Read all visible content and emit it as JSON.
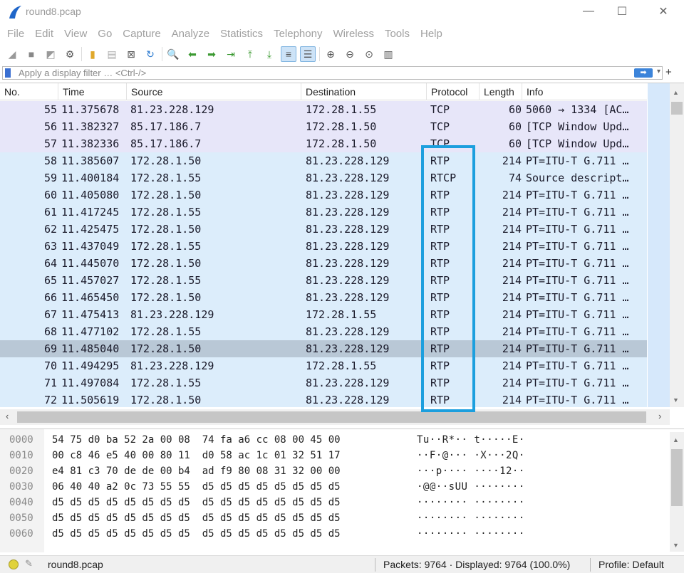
{
  "window": {
    "title": "round8.pcap",
    "minimize": "—",
    "maximize": "☐",
    "close": "✕"
  },
  "menu": [
    "File",
    "Edit",
    "View",
    "Go",
    "Capture",
    "Analyze",
    "Statistics",
    "Telephony",
    "Wireless",
    "Tools",
    "Help"
  ],
  "filter": {
    "placeholder": "Apply a display filter … <Ctrl-/>",
    "apply": "➡",
    "dropdown": "▾",
    "plus": "+"
  },
  "columns": {
    "no": "No.",
    "time": "Time",
    "source": "Source",
    "destination": "Destination",
    "protocol": "Protocol",
    "length": "Length",
    "info": "Info"
  },
  "packets": [
    {
      "no": "55",
      "time": "11.375678",
      "src": "81.23.228.129",
      "dst": "172.28.1.55",
      "proto": "TCP",
      "len": "60",
      "info": "5060 → 1334 [AC…"
    },
    {
      "no": "56",
      "time": "11.382327",
      "src": "85.17.186.7",
      "dst": "172.28.1.50",
      "proto": "TCP",
      "len": "60",
      "info": "[TCP Window Upd…"
    },
    {
      "no": "57",
      "time": "11.382336",
      "src": "85.17.186.7",
      "dst": "172.28.1.50",
      "proto": "TCP",
      "len": "60",
      "info": "[TCP Window Upd…"
    },
    {
      "no": "58",
      "time": "11.385607",
      "src": "172.28.1.50",
      "dst": "81.23.228.129",
      "proto": "RTP",
      "len": "214",
      "info": "PT=ITU-T G.711 …"
    },
    {
      "no": "59",
      "time": "11.400184",
      "src": "172.28.1.55",
      "dst": "81.23.228.129",
      "proto": "RTCP",
      "len": "74",
      "info": "Source descript…"
    },
    {
      "no": "60",
      "time": "11.405080",
      "src": "172.28.1.50",
      "dst": "81.23.228.129",
      "proto": "RTP",
      "len": "214",
      "info": "PT=ITU-T G.711 …"
    },
    {
      "no": "61",
      "time": "11.417245",
      "src": "172.28.1.55",
      "dst": "81.23.228.129",
      "proto": "RTP",
      "len": "214",
      "info": "PT=ITU-T G.711 …"
    },
    {
      "no": "62",
      "time": "11.425475",
      "src": "172.28.1.50",
      "dst": "81.23.228.129",
      "proto": "RTP",
      "len": "214",
      "info": "PT=ITU-T G.711 …"
    },
    {
      "no": "63",
      "time": "11.437049",
      "src": "172.28.1.55",
      "dst": "81.23.228.129",
      "proto": "RTP",
      "len": "214",
      "info": "PT=ITU-T G.711 …"
    },
    {
      "no": "64",
      "time": "11.445070",
      "src": "172.28.1.50",
      "dst": "81.23.228.129",
      "proto": "RTP",
      "len": "214",
      "info": "PT=ITU-T G.711 …"
    },
    {
      "no": "65",
      "time": "11.457027",
      "src": "172.28.1.55",
      "dst": "81.23.228.129",
      "proto": "RTP",
      "len": "214",
      "info": "PT=ITU-T G.711 …"
    },
    {
      "no": "66",
      "time": "11.465450",
      "src": "172.28.1.50",
      "dst": "81.23.228.129",
      "proto": "RTP",
      "len": "214",
      "info": "PT=ITU-T G.711 …"
    },
    {
      "no": "67",
      "time": "11.475413",
      "src": "81.23.228.129",
      "dst": "172.28.1.55",
      "proto": "RTP",
      "len": "214",
      "info": "PT=ITU-T G.711 …"
    },
    {
      "no": "68",
      "time": "11.477102",
      "src": "172.28.1.55",
      "dst": "81.23.228.129",
      "proto": "RTP",
      "len": "214",
      "info": "PT=ITU-T G.711 …"
    },
    {
      "no": "69",
      "time": "11.485040",
      "src": "172.28.1.50",
      "dst": "81.23.228.129",
      "proto": "RTP",
      "len": "214",
      "info": "PT=ITU-T G.711 …",
      "selected": true
    },
    {
      "no": "70",
      "time": "11.494295",
      "src": "81.23.228.129",
      "dst": "172.28.1.55",
      "proto": "RTP",
      "len": "214",
      "info": "PT=ITU-T G.711 …"
    },
    {
      "no": "71",
      "time": "11.497084",
      "src": "172.28.1.55",
      "dst": "81.23.228.129",
      "proto": "RTP",
      "len": "214",
      "info": "PT=ITU-T G.711 …"
    },
    {
      "no": "72",
      "time": "11.505619",
      "src": "172.28.1.50",
      "dst": "81.23.228.129",
      "proto": "RTP",
      "len": "214",
      "info": "PT=ITU-T G.711 …"
    }
  ],
  "hex": [
    {
      "off": "0000",
      "bytes": "54 75 d0 ba 52 2a 00 08  74 fa a6 cc 08 00 45 00",
      "ascii": "Tu··R*·· t·····E·"
    },
    {
      "off": "0010",
      "bytes": "00 c8 46 e5 40 00 80 11  d0 58 ac 1c 01 32 51 17",
      "ascii": "··F·@··· ·X···2Q·"
    },
    {
      "off": "0020",
      "bytes": "e4 81 c3 70 de de 00 b4  ad f9 80 08 31 32 00 00",
      "ascii": "···p···· ····12··"
    },
    {
      "off": "0030",
      "bytes": "06 40 40 a2 0c 73 55 55  d5 d5 d5 d5 d5 d5 d5 d5",
      "ascii": "·@@··sUU ········"
    },
    {
      "off": "0040",
      "bytes": "d5 d5 d5 d5 d5 d5 d5 d5  d5 d5 d5 d5 d5 d5 d5 d5",
      "ascii": "········ ········"
    },
    {
      "off": "0050",
      "bytes": "d5 d5 d5 d5 d5 d5 d5 d5  d5 d5 d5 d5 d5 d5 d5 d5",
      "ascii": "········ ········"
    },
    {
      "off": "0060",
      "bytes": "d5 d5 d5 d5 d5 d5 d5 d5  d5 d5 d5 d5 d5 d5 d5 d5",
      "ascii": "········ ········"
    }
  ],
  "status": {
    "file": "round8.pcap",
    "packets": "Packets: 9764 · Displayed: 9764 (100.0%)",
    "profile": "Profile: Default"
  },
  "colors": {
    "tcp_row": "#e7e6f9",
    "udp_row": "#dcedfb",
    "selected_row": "#b9c8d6",
    "highlight": "#1c9fde"
  }
}
